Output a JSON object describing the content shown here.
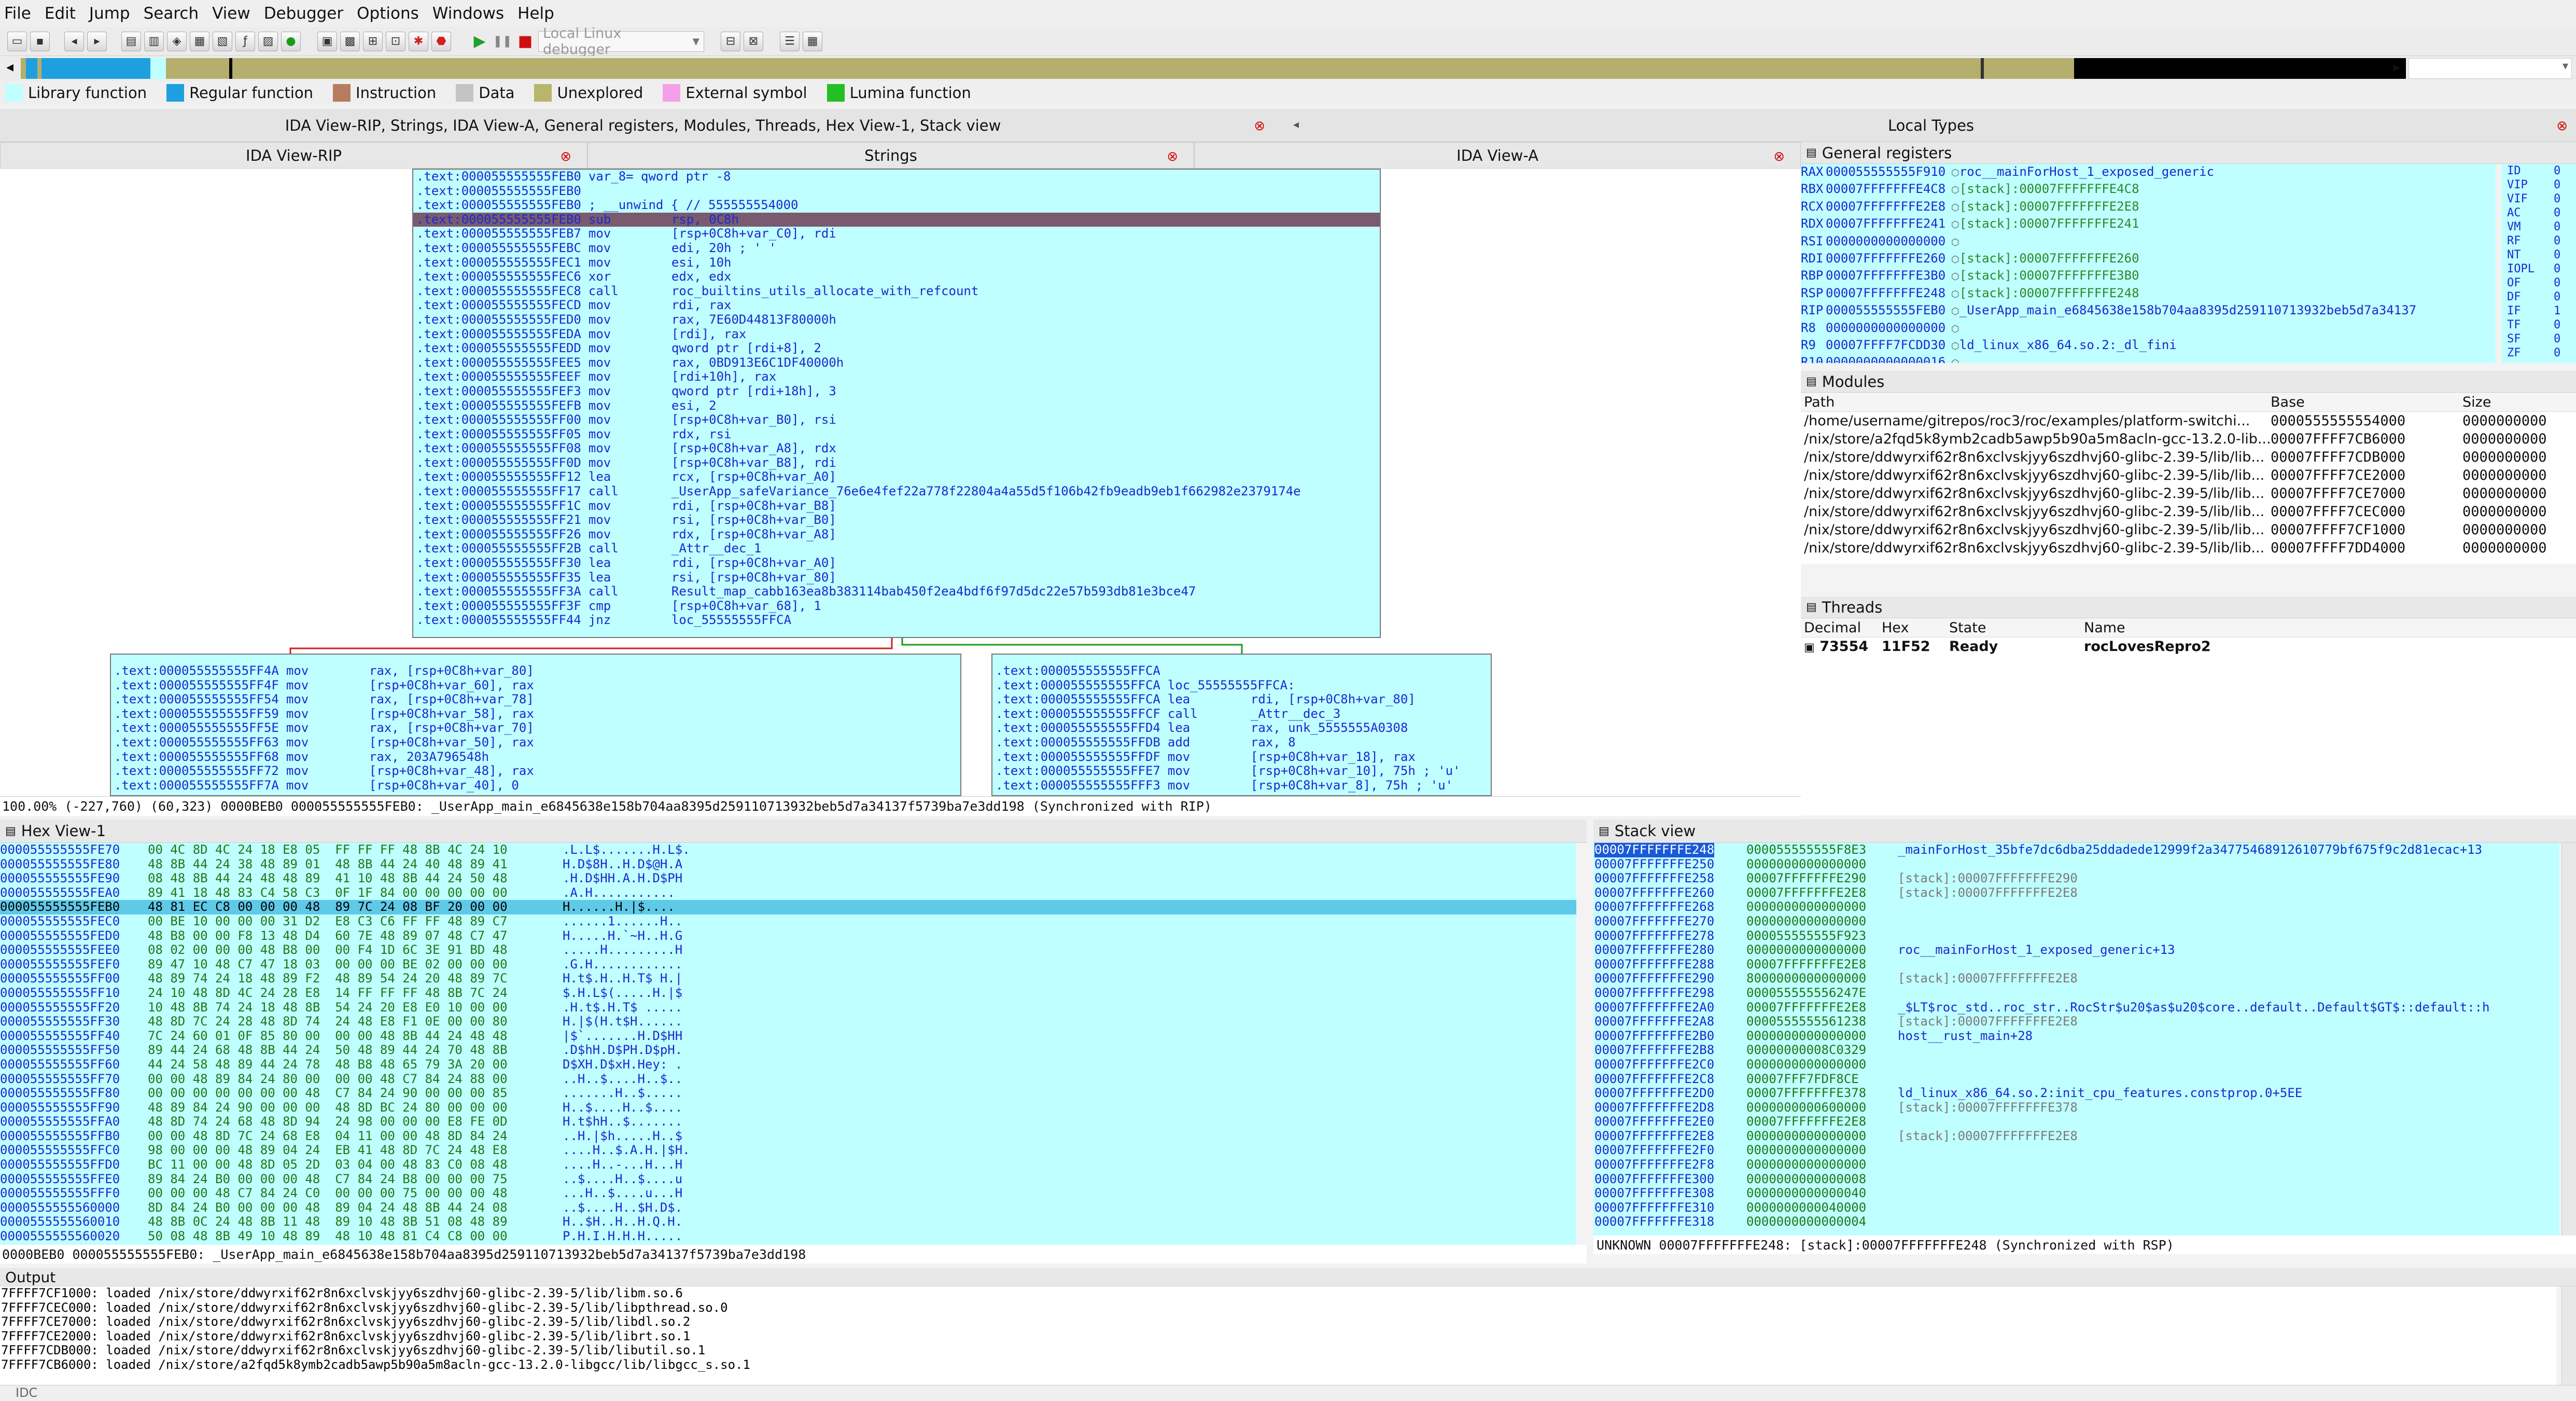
{
  "menu": [
    "File",
    "Edit",
    "Jump",
    "Search",
    "View",
    "Debugger",
    "Options",
    "Windows",
    "Help"
  ],
  "toolbar": {
    "debugger": "Local Linux debugger"
  },
  "legend": [
    {
      "label": "Library function",
      "color": "#c0ffff"
    },
    {
      "label": "Regular function",
      "color": "#1ea0e0"
    },
    {
      "label": "Instruction",
      "color": "#b77c5e"
    },
    {
      "label": "Data",
      "color": "#c4c4c4"
    },
    {
      "label": "Unexplored",
      "color": "#b8b56c"
    },
    {
      "label": "External symbol",
      "color": "#f4a0e8"
    },
    {
      "label": "Lumina function",
      "color": "#22c022"
    }
  ],
  "docks": {
    "left_title": "IDA View-RIP, Strings, IDA View-A, General registers, Modules, Threads, Hex View-1, Stack view",
    "right_title": "Local Types",
    "tabs": [
      "IDA View-RIP",
      "Strings",
      "IDA View-A"
    ]
  },
  "graph": {
    "main_node": [
      {
        "a": ".text:000055555555FEB0",
        "m": "var_8= qword ptr -8",
        "o": ""
      },
      {
        "a": ".text:000055555555FEB0",
        "m": "",
        "o": ""
      },
      {
        "a": ".text:000055555555FEB0",
        "m": "; __unwind { // 555555554000",
        "o": ""
      },
      {
        "a": ".text:000055555555FEB0",
        "m": "sub",
        "o": "rsp, 0C8h",
        "sel": true
      },
      {
        "a": ".text:000055555555FEB7",
        "m": "mov",
        "o": "[rsp+0C8h+var_C0], rdi"
      },
      {
        "a": ".text:000055555555FEBC",
        "m": "mov",
        "o": "edi, 20h ; ' '"
      },
      {
        "a": ".text:000055555555FEC1",
        "m": "mov",
        "o": "esi, 10h"
      },
      {
        "a": ".text:000055555555FEC6",
        "m": "xor",
        "o": "edx, edx"
      },
      {
        "a": ".text:000055555555FEC8",
        "m": "call",
        "o": "roc_builtins_utils_allocate_with_refcount"
      },
      {
        "a": ".text:000055555555FECD",
        "m": "mov",
        "o": "rdi, rax"
      },
      {
        "a": ".text:000055555555FED0",
        "m": "mov",
        "o": "rax, 7E60D44813F80000h"
      },
      {
        "a": ".text:000055555555FEDA",
        "m": "mov",
        "o": "[rdi], rax"
      },
      {
        "a": ".text:000055555555FEDD",
        "m": "mov",
        "o": "qword ptr [rdi+8], 2"
      },
      {
        "a": ".text:000055555555FEE5",
        "m": "mov",
        "o": "rax, 0BD913E6C1DF40000h"
      },
      {
        "a": ".text:000055555555FEEF",
        "m": "mov",
        "o": "[rdi+10h], rax"
      },
      {
        "a": ".text:000055555555FEF3",
        "m": "mov",
        "o": "qword ptr [rdi+18h], 3"
      },
      {
        "a": ".text:000055555555FEFB",
        "m": "mov",
        "o": "esi, 2"
      },
      {
        "a": ".text:000055555555FF00",
        "m": "mov",
        "o": "[rsp+0C8h+var_B0], rsi"
      },
      {
        "a": ".text:000055555555FF05",
        "m": "mov",
        "o": "rdx, rsi"
      },
      {
        "a": ".text:000055555555FF08",
        "m": "mov",
        "o": "[rsp+0C8h+var_A8], rdx"
      },
      {
        "a": ".text:000055555555FF0D",
        "m": "mov",
        "o": "[rsp+0C8h+var_B8], rdi"
      },
      {
        "a": ".text:000055555555FF12",
        "m": "lea",
        "o": "rcx, [rsp+0C8h+var_A0]"
      },
      {
        "a": ".text:000055555555FF17",
        "m": "call",
        "o": "_UserApp_safeVariance_76e6e4fef22a778f22804a4a55d5f106b42fb9eadb9eb1f662982e2379174e"
      },
      {
        "a": ".text:000055555555FF1C",
        "m": "mov",
        "o": "rdi, [rsp+0C8h+var_B8]"
      },
      {
        "a": ".text:000055555555FF21",
        "m": "mov",
        "o": "rsi, [rsp+0C8h+var_B0]"
      },
      {
        "a": ".text:000055555555FF26",
        "m": "mov",
        "o": "rdx, [rsp+0C8h+var_A8]"
      },
      {
        "a": ".text:000055555555FF2B",
        "m": "call",
        "o": "_Attr__dec_1"
      },
      {
        "a": ".text:000055555555FF30",
        "m": "lea",
        "o": "rdi, [rsp+0C8h+var_A0]"
      },
      {
        "a": ".text:000055555555FF35",
        "m": "lea",
        "o": "rsi, [rsp+0C8h+var_80]"
      },
      {
        "a": ".text:000055555555FF3A",
        "m": "call",
        "o": "Result_map_cabb163ea8b383114bab450f2ea4bdf6f97d5dc22e57b593db81e3bce47"
      },
      {
        "a": ".text:000055555555FF3F",
        "m": "cmp",
        "o": "[rsp+0C8h+var_68], 1"
      },
      {
        "a": ".text:000055555555FF44",
        "m": "jnz",
        "o": "loc_55555555FFCA"
      }
    ],
    "left_node": [
      {
        "a": ".text:000055555555FF4A",
        "m": "mov",
        "o": "rax, [rsp+0C8h+var_80]"
      },
      {
        "a": ".text:000055555555FF4F",
        "m": "mov",
        "o": "[rsp+0C8h+var_60], rax"
      },
      {
        "a": ".text:000055555555FF54",
        "m": "mov",
        "o": "rax, [rsp+0C8h+var_78]"
      },
      {
        "a": ".text:000055555555FF59",
        "m": "mov",
        "o": "[rsp+0C8h+var_58], rax"
      },
      {
        "a": ".text:000055555555FF5E",
        "m": "mov",
        "o": "rax, [rsp+0C8h+var_70]"
      },
      {
        "a": ".text:000055555555FF63",
        "m": "mov",
        "o": "[rsp+0C8h+var_50], rax"
      },
      {
        "a": ".text:000055555555FF68",
        "m": "mov",
        "o": "rax, 203A796548h"
      },
      {
        "a": ".text:000055555555FF72",
        "m": "mov",
        "o": "[rsp+0C8h+var_48], rax"
      },
      {
        "a": ".text:000055555555FF7A",
        "m": "mov",
        "o": "[rsp+0C8h+var_40], 0"
      }
    ],
    "right_node": [
      {
        "a": ".text:000055555555FFCA",
        "m": "",
        "o": ""
      },
      {
        "a": ".text:000055555555FFCA",
        "m": "loc_55555555FFCA:",
        "o": ""
      },
      {
        "a": ".text:000055555555FFCA",
        "m": "lea",
        "o": "rdi, [rsp+0C8h+var_80]"
      },
      {
        "a": ".text:000055555555FFCF",
        "m": "call",
        "o": "_Attr__dec_3"
      },
      {
        "a": ".text:000055555555FFD4",
        "m": "lea",
        "o": "rax, unk_5555555A0308"
      },
      {
        "a": ".text:000055555555FFDB",
        "m": "add",
        "o": "rax, 8"
      },
      {
        "a": ".text:000055555555FFDF",
        "m": "mov",
        "o": "[rsp+0C8h+var_18], rax"
      },
      {
        "a": ".text:000055555555FFE7",
        "m": "mov",
        "o": "[rsp+0C8h+var_10], 75h ; 'u'"
      },
      {
        "a": ".text:000055555555FFF3",
        "m": "mov",
        "o": "[rsp+0C8h+var_8], 75h ; 'u'"
      }
    ],
    "status": "100.00% (-227,760) (60,323) 0000BEB0 000055555555FEB0: _UserApp_main_e6845638e158b704aa8395d259110713932beb5d7a34137f5739ba7e3dd198 (Synchronized with RIP)"
  },
  "registers": {
    "title": "General registers",
    "rows": [
      {
        "n": "RAX",
        "v": "000055555555F910",
        "c": "",
        "l": "roc__mainForHost_1_exposed_generic"
      },
      {
        "n": "RBX",
        "v": "00007FFFFFFFE4C8",
        "c": "[stack]:00007FFFFFFFE4C8",
        "l": ""
      },
      {
        "n": "RCX",
        "v": "00007FFFFFFFE2E8",
        "c": "[stack]:00007FFFFFFFE2E8",
        "l": ""
      },
      {
        "n": "RDX",
        "v": "00007FFFFFFFE241",
        "c": "[stack]:00007FFFFFFFE241",
        "l": ""
      },
      {
        "n": "RSI",
        "v": "0000000000000000",
        "c": "",
        "l": ""
      },
      {
        "n": "RDI",
        "v": "00007FFFFFFFE260",
        "c": "[stack]:00007FFFFFFFE260",
        "l": ""
      },
      {
        "n": "RBP",
        "v": "00007FFFFFFFE3B0",
        "c": "[stack]:00007FFFFFFFE3B0",
        "l": ""
      },
      {
        "n": "RSP",
        "v": "00007FFFFFFFE248",
        "c": "[stack]:00007FFFFFFFE248",
        "l": ""
      },
      {
        "n": "RIP",
        "v": "000055555555FEB0",
        "c": "",
        "l": "_UserApp_main_e6845638e158b704aa8395d259110713932beb5d7a34137"
      },
      {
        "n": "R8",
        "v": "0000000000000000",
        "c": "",
        "l": ""
      },
      {
        "n": "R9",
        "v": "00007FFFF7FCDD30",
        "c": "",
        "l": "ld_linux_x86_64.so.2:_dl_fini"
      },
      {
        "n": "R10",
        "v": "0000000000000016",
        "c": "",
        "l": ""
      }
    ],
    "flags": [
      {
        "n": "ID",
        "v": "0"
      },
      {
        "n": "VIP",
        "v": "0"
      },
      {
        "n": "VIF",
        "v": "0"
      },
      {
        "n": "AC",
        "v": "0"
      },
      {
        "n": "VM",
        "v": "0"
      },
      {
        "n": "RF",
        "v": "0"
      },
      {
        "n": "NT",
        "v": "0"
      },
      {
        "n": "IOPL",
        "v": "0"
      },
      {
        "n": "OF",
        "v": "0"
      },
      {
        "n": "DF",
        "v": "0"
      },
      {
        "n": "IF",
        "v": "1"
      },
      {
        "n": "TF",
        "v": "0"
      },
      {
        "n": "SF",
        "v": "0"
      },
      {
        "n": "ZF",
        "v": "0"
      }
    ]
  },
  "modules": {
    "title": "Modules",
    "headers": [
      "Path",
      "Base",
      "Size"
    ],
    "rows": [
      {
        "p": "/home/username/gitrepos/roc3/roc/examples/platform-switchi...",
        "b": "0000555555554000",
        "s": "0000000000"
      },
      {
        "p": "/nix/store/a2fqd5k8ymb2cadb5awp5b90a5m8acln-gcc-13.2.0-lib...",
        "b": "00007FFFF7CB6000",
        "s": "0000000000"
      },
      {
        "p": "/nix/store/ddwyrxif62r8n6xclvskjyy6szdhvj60-glibc-2.39-5/lib/lib...",
        "b": "00007FFFF7CDB000",
        "s": "0000000000"
      },
      {
        "p": "/nix/store/ddwyrxif62r8n6xclvskjyy6szdhvj60-glibc-2.39-5/lib/lib...",
        "b": "00007FFFF7CE2000",
        "s": "0000000000"
      },
      {
        "p": "/nix/store/ddwyrxif62r8n6xclvskjyy6szdhvj60-glibc-2.39-5/lib/lib...",
        "b": "00007FFFF7CE7000",
        "s": "0000000000"
      },
      {
        "p": "/nix/store/ddwyrxif62r8n6xclvskjyy6szdhvj60-glibc-2.39-5/lib/lib...",
        "b": "00007FFFF7CEC000",
        "s": "0000000000"
      },
      {
        "p": "/nix/store/ddwyrxif62r8n6xclvskjyy6szdhvj60-glibc-2.39-5/lib/lib...",
        "b": "00007FFFF7CF1000",
        "s": "0000000000"
      },
      {
        "p": "/nix/store/ddwyrxif62r8n6xclvskjyy6szdhvj60-glibc-2.39-5/lib/lib...",
        "b": "00007FFFF7DD4000",
        "s": "0000000000"
      }
    ]
  },
  "threads": {
    "title": "Threads",
    "headers": [
      "Decimal",
      "Hex",
      "State",
      "Name"
    ],
    "rows": [
      {
        "d": "73554",
        "h": "11F52",
        "s": "Ready",
        "n": "rocLovesRepro2"
      }
    ]
  },
  "hexview": {
    "title": "Hex View-1",
    "rows": [
      {
        "a": "000055555555FE70",
        "b": "00 4C 8D 4C 24 18 E8 05  FF FF FF 48 8B 4C 24 10",
        "c": ".L.L$.......H.L$."
      },
      {
        "a": "000055555555FE80",
        "b": "48 8B 44 24 38 48 89 01  48 8B 44 24 40 48 89 41",
        "c": "H.D$8H..H.D$@H.A"
      },
      {
        "a": "000055555555FE90",
        "b": "08 48 8B 44 24 48 48 89  41 10 48 8B 44 24 50 48",
        "c": ".H.D$HH.A.H.D$PH"
      },
      {
        "a": "000055555555FEA0",
        "b": "89 41 18 48 83 C4 58 C3  0F 1F 84 00 00 00 00 00",
        "c": ".A.H..........."
      },
      {
        "a": "000055555555FEB0",
        "b": "48 81 EC C8 00 00 00 48  89 7C 24 08 BF 20 00 00",
        "c": "H......H.|$....",
        "sel": true
      },
      {
        "a": "000055555555FEC0",
        "b": "00 BE 10 00 00 00 31 D2  E8 C3 C6 FF FF 48 89 C7",
        "c": "......1......H.."
      },
      {
        "a": "000055555555FED0",
        "b": "48 B8 00 00 F8 13 48 D4  60 7E 48 89 07 48 C7 47",
        "c": "H.....H.`~H..H.G"
      },
      {
        "a": "000055555555FEE0",
        "b": "08 02 00 00 00 48 B8 00  00 F4 1D 6C 3E 91 BD 48",
        "c": ".....H.........H"
      },
      {
        "a": "000055555555FEF0",
        "b": "89 47 10 48 C7 47 18 03  00 00 00 BE 02 00 00 00",
        "c": ".G.H............"
      },
      {
        "a": "000055555555FF00",
        "b": "48 89 74 24 18 48 89 F2  48 89 54 24 20 48 89 7C",
        "c": "H.t$.H..H.T$ H.|"
      },
      {
        "a": "000055555555FF10",
        "b": "24 10 48 8D 4C 24 28 E8  14 FF FF FF 48 8B 7C 24",
        "c": "$.H.L$(.....H.|$"
      },
      {
        "a": "000055555555FF20",
        "b": "10 48 8B 74 24 18 48 8B  54 24 20 E8 E0 10 00 00",
        "c": ".H.t$.H.T$ ....."
      },
      {
        "a": "000055555555FF30",
        "b": "48 8D 7C 24 28 48 8D 74  24 48 E8 F1 0E 00 00 80",
        "c": "H.|$(H.t$H......"
      },
      {
        "a": "000055555555FF40",
        "b": "7C 24 60 01 0F 85 80 00  00 00 48 8B 44 24 48 48",
        "c": "|$`.......H.D$HH"
      },
      {
        "a": "000055555555FF50",
        "b": "89 44 24 68 48 8B 44 24  50 48 89 44 24 70 48 8B",
        "c": ".D$hH.D$PH.D$pH."
      },
      {
        "a": "000055555555FF60",
        "b": "44 24 58 48 89 44 24 78  48 B8 48 65 79 3A 20 00",
        "c": "D$XH.D$xH.Hey: ."
      },
      {
        "a": "000055555555FF70",
        "b": "00 00 48 89 84 24 80 00  00 00 48 C7 84 24 88 00",
        "c": "..H..$....H..$.."
      },
      {
        "a": "000055555555FF80",
        "b": "00 00 00 00 00 00 00 48  C7 84 24 90 00 00 00 85",
        "c": ".......H..$....."
      },
      {
        "a": "000055555555FF90",
        "b": "48 89 84 24 90 00 00 00  48 8D BC 24 80 00 00 00",
        "c": "H..$....H..$...."
      },
      {
        "a": "000055555555FFA0",
        "b": "48 8D 74 24 68 48 8D 94  24 98 00 00 00 E8 FE 0D",
        "c": "H.t$hH..$......."
      },
      {
        "a": "000055555555FFB0",
        "b": "00 00 48 8D 7C 24 68 E8  04 11 00 00 48 8D 84 24",
        "c": "..H.|$h.....H..$"
      },
      {
        "a": "000055555555FFC0",
        "b": "98 00 00 00 48 89 04 24  EB 41 48 8D 7C 24 48 E8",
        "c": "....H..$.A.H.|$H."
      },
      {
        "a": "000055555555FFD0",
        "b": "BC 11 00 00 48 8D 05 2D  03 04 00 48 83 C0 08 48",
        "c": "....H..-...H...H"
      },
      {
        "a": "000055555555FFE0",
        "b": "89 84 24 B0 00 00 00 48  C7 84 24 B8 00 00 00 75",
        "c": "..$....H..$....u"
      },
      {
        "a": "000055555555FFF0",
        "b": "00 00 00 48 C7 84 24 C0  00 00 00 75 00 00 00 48",
        "c": "...H..$....u...H"
      },
      {
        "a": "0000555555560000",
        "b": "8D 84 24 B0 00 00 00 48  89 04 24 48 8B 44 24 08",
        "c": "..$....H..$H.D$."
      },
      {
        "a": "0000555555560010",
        "b": "48 8B 0C 24 48 8B 11 48  89 10 48 8B 51 08 48 89",
        "c": "H..$H..H..H.Q.H."
      },
      {
        "a": "0000555555560020",
        "b": "50 08 48 8B 49 10 48 89  48 10 48 81 C4 C8 00 00",
        "c": "P.H.I.H.H.H....."
      }
    ],
    "status": "0000BEB0 000055555555FEB0: _UserApp_main_e6845638e158b704aa8395d259110713932beb5d7a34137f5739ba7e3dd198"
  },
  "stackview": {
    "title": "Stack view",
    "rows": [
      {
        "a": "00007FFFFFFFE248",
        "v": "000055555555F8E3",
        "c": "_mainForHost_35bfe7dc6dba25ddadede12999f2a34775468912610779bf675f9c2d81ecac+13",
        "sel": true
      },
      {
        "a": "00007FFFFFFFE250",
        "v": "0000000000000000",
        "c": ""
      },
      {
        "a": "00007FFFFFFFE258",
        "v": "00007FFFFFFFE290",
        "c": "[stack]:00007FFFFFFFE290",
        "cm": true
      },
      {
        "a": "00007FFFFFFFE260",
        "v": "00007FFFFFFFE2E8",
        "c": "[stack]:00007FFFFFFFE2E8",
        "cm": true
      },
      {
        "a": "00007FFFFFFFE268",
        "v": "0000000000000000",
        "c": ""
      },
      {
        "a": "00007FFFFFFFE270",
        "v": "0000000000000000",
        "c": ""
      },
      {
        "a": "00007FFFFFFFE278",
        "v": "000055555555F923",
        "c": ""
      },
      {
        "a": "00007FFFFFFFE280",
        "v": "0000000000000000",
        "c": "roc__mainForHost_1_exposed_generic+13"
      },
      {
        "a": "00007FFFFFFFE288",
        "v": "00007FFFFFFFE2E8",
        "c": ""
      },
      {
        "a": "00007FFFFFFFE290",
        "v": "8000000000000000",
        "c": "[stack]:00007FFFFFFFE2E8",
        "cm": true
      },
      {
        "a": "00007FFFFFFFE298",
        "v": "000055555556247E",
        "c": ""
      },
      {
        "a": "00007FFFFFFFE2A0",
        "v": "00007FFFFFFFE2E8",
        "c": "_$LT$roc_std..roc_str..RocStr$u20$as$u20$core..default..Default$GT$::default::h"
      },
      {
        "a": "00007FFFFFFFE2A8",
        "v": "0000555555561238",
        "c": "[stack]:00007FFFFFFFE2E8",
        "cm": true
      },
      {
        "a": "00007FFFFFFFE2B0",
        "v": "0000000000000000",
        "c": "host__rust_main+28"
      },
      {
        "a": "00007FFFFFFFE2B8",
        "v": "00000000008C0329",
        "c": ""
      },
      {
        "a": "00007FFFFFFFE2C0",
        "v": "0000000000000000",
        "c": ""
      },
      {
        "a": "00007FFFFFFFE2C8",
        "v": "00007FFF7FDF8CE",
        "c": ""
      },
      {
        "a": "00007FFFFFFFE2D0",
        "v": "00007FFFFFFFE378",
        "c": "ld_linux_x86_64.so.2:init_cpu_features.constprop.0+5EE"
      },
      {
        "a": "00007FFFFFFFE2D8",
        "v": "0000000000600000",
        "c": "[stack]:00007FFFFFFFE378",
        "cm": true
      },
      {
        "a": "00007FFFFFFFE2E0",
        "v": "00007FFFFFFFE2E8",
        "c": ""
      },
      {
        "a": "00007FFFFFFFE2E8",
        "v": "0000000000000000",
        "c": "[stack]:00007FFFFFFFE2E8",
        "cm": true
      },
      {
        "a": "00007FFFFFFFE2F0",
        "v": "0000000000000000",
        "c": ""
      },
      {
        "a": "00007FFFFFFFE2F8",
        "v": "0000000000000000",
        "c": ""
      },
      {
        "a": "00007FFFFFFFE300",
        "v": "0000000000000008",
        "c": ""
      },
      {
        "a": "00007FFFFFFFE308",
        "v": "0000000000000040",
        "c": ""
      },
      {
        "a": "00007FFFFFFFE310",
        "v": "0000000000040000",
        "c": ""
      },
      {
        "a": "00007FFFFFFFE318",
        "v": "0000000000000004",
        "c": ""
      }
    ],
    "status": "UNKNOWN 00007FFFFFFFE248: [stack]:00007FFFFFFFE248 (Synchronized with RSP)"
  },
  "output": {
    "title": "Output",
    "lines": [
      "7FFFF7CF1000: loaded /nix/store/ddwyrxif62r8n6xclvskjyy6szdhvj60-glibc-2.39-5/lib/libm.so.6",
      "7FFFF7CEC000: loaded /nix/store/ddwyrxif62r8n6xclvskjyy6szdhvj60-glibc-2.39-5/lib/libpthread.so.0",
      "7FFFF7CE7000: loaded /nix/store/ddwyrxif62r8n6xclvskjyy6szdhvj60-glibc-2.39-5/lib/libdl.so.2",
      "7FFFF7CE2000: loaded /nix/store/ddwyrxif62r8n6xclvskjyy6szdhvj60-glibc-2.39-5/lib/librt.so.1",
      "7FFFF7CDB000: loaded /nix/store/ddwyrxif62r8n6xclvskjyy6szdhvj60-glibc-2.39-5/lib/libutil.so.1",
      "7FFFF7CB6000: loaded /nix/store/a2fqd5k8ymb2cadb5awp5b90a5m8acln-gcc-13.2.0-libgcc/lib/libgcc_s.so.1"
    ],
    "prompt": "IDC"
  }
}
